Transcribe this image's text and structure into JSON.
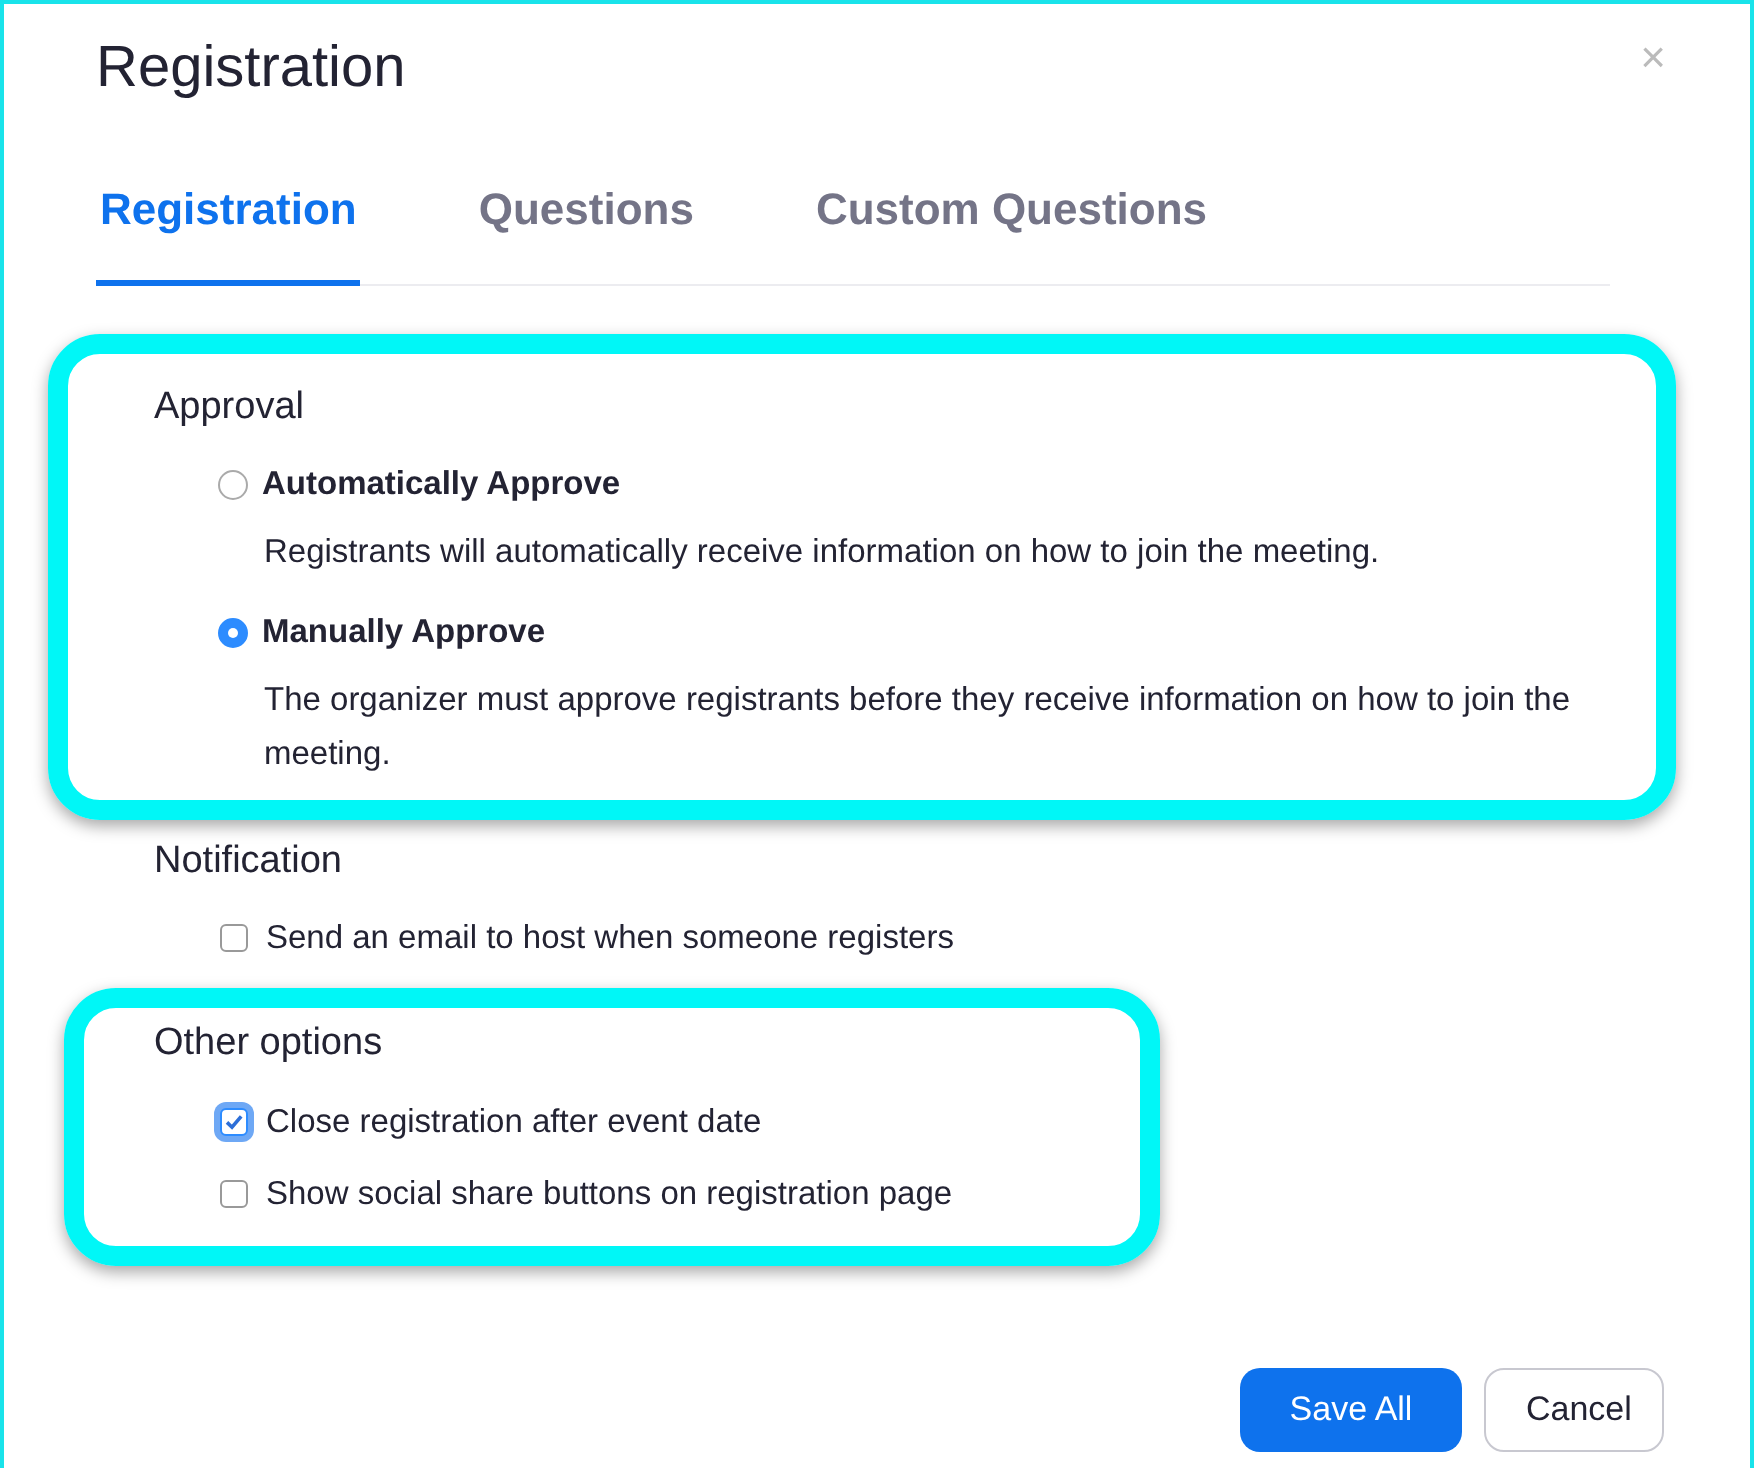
{
  "window": {
    "title": "Registration",
    "close": "×"
  },
  "tabs": [
    {
      "label": "Registration",
      "selected": true
    },
    {
      "label": "Questions",
      "selected": false
    },
    {
      "label": "Custom Questions",
      "selected": false
    }
  ],
  "sections": [
    {
      "title": "Approval",
      "highlighted": true,
      "options": [
        {
          "kind": "radio",
          "label": "Automatically Approve",
          "selected": false,
          "description": "Registrants will automatically receive information on how to join the meeting."
        },
        {
          "kind": "radio",
          "label": "Manually Approve",
          "selected": true,
          "description": "The organizer must approve registrants before they receive information on how to join the meeting."
        }
      ]
    },
    {
      "title": "Notification",
      "highlighted": false,
      "options": [
        {
          "kind": "checkbox",
          "label": "Send an email to host when someone registers",
          "checked": false
        }
      ]
    },
    {
      "title": "Other options",
      "highlighted": true,
      "options": [
        {
          "kind": "checkbox",
          "label": "Close registration after event date",
          "checked": true
        },
        {
          "kind": "checkbox",
          "label": "Show social share buttons on registration page",
          "checked": false
        }
      ]
    }
  ],
  "buttons": [
    {
      "label": "Save All",
      "kind": "primary"
    },
    {
      "label": "Cancel",
      "kind": "secondary"
    }
  ]
}
